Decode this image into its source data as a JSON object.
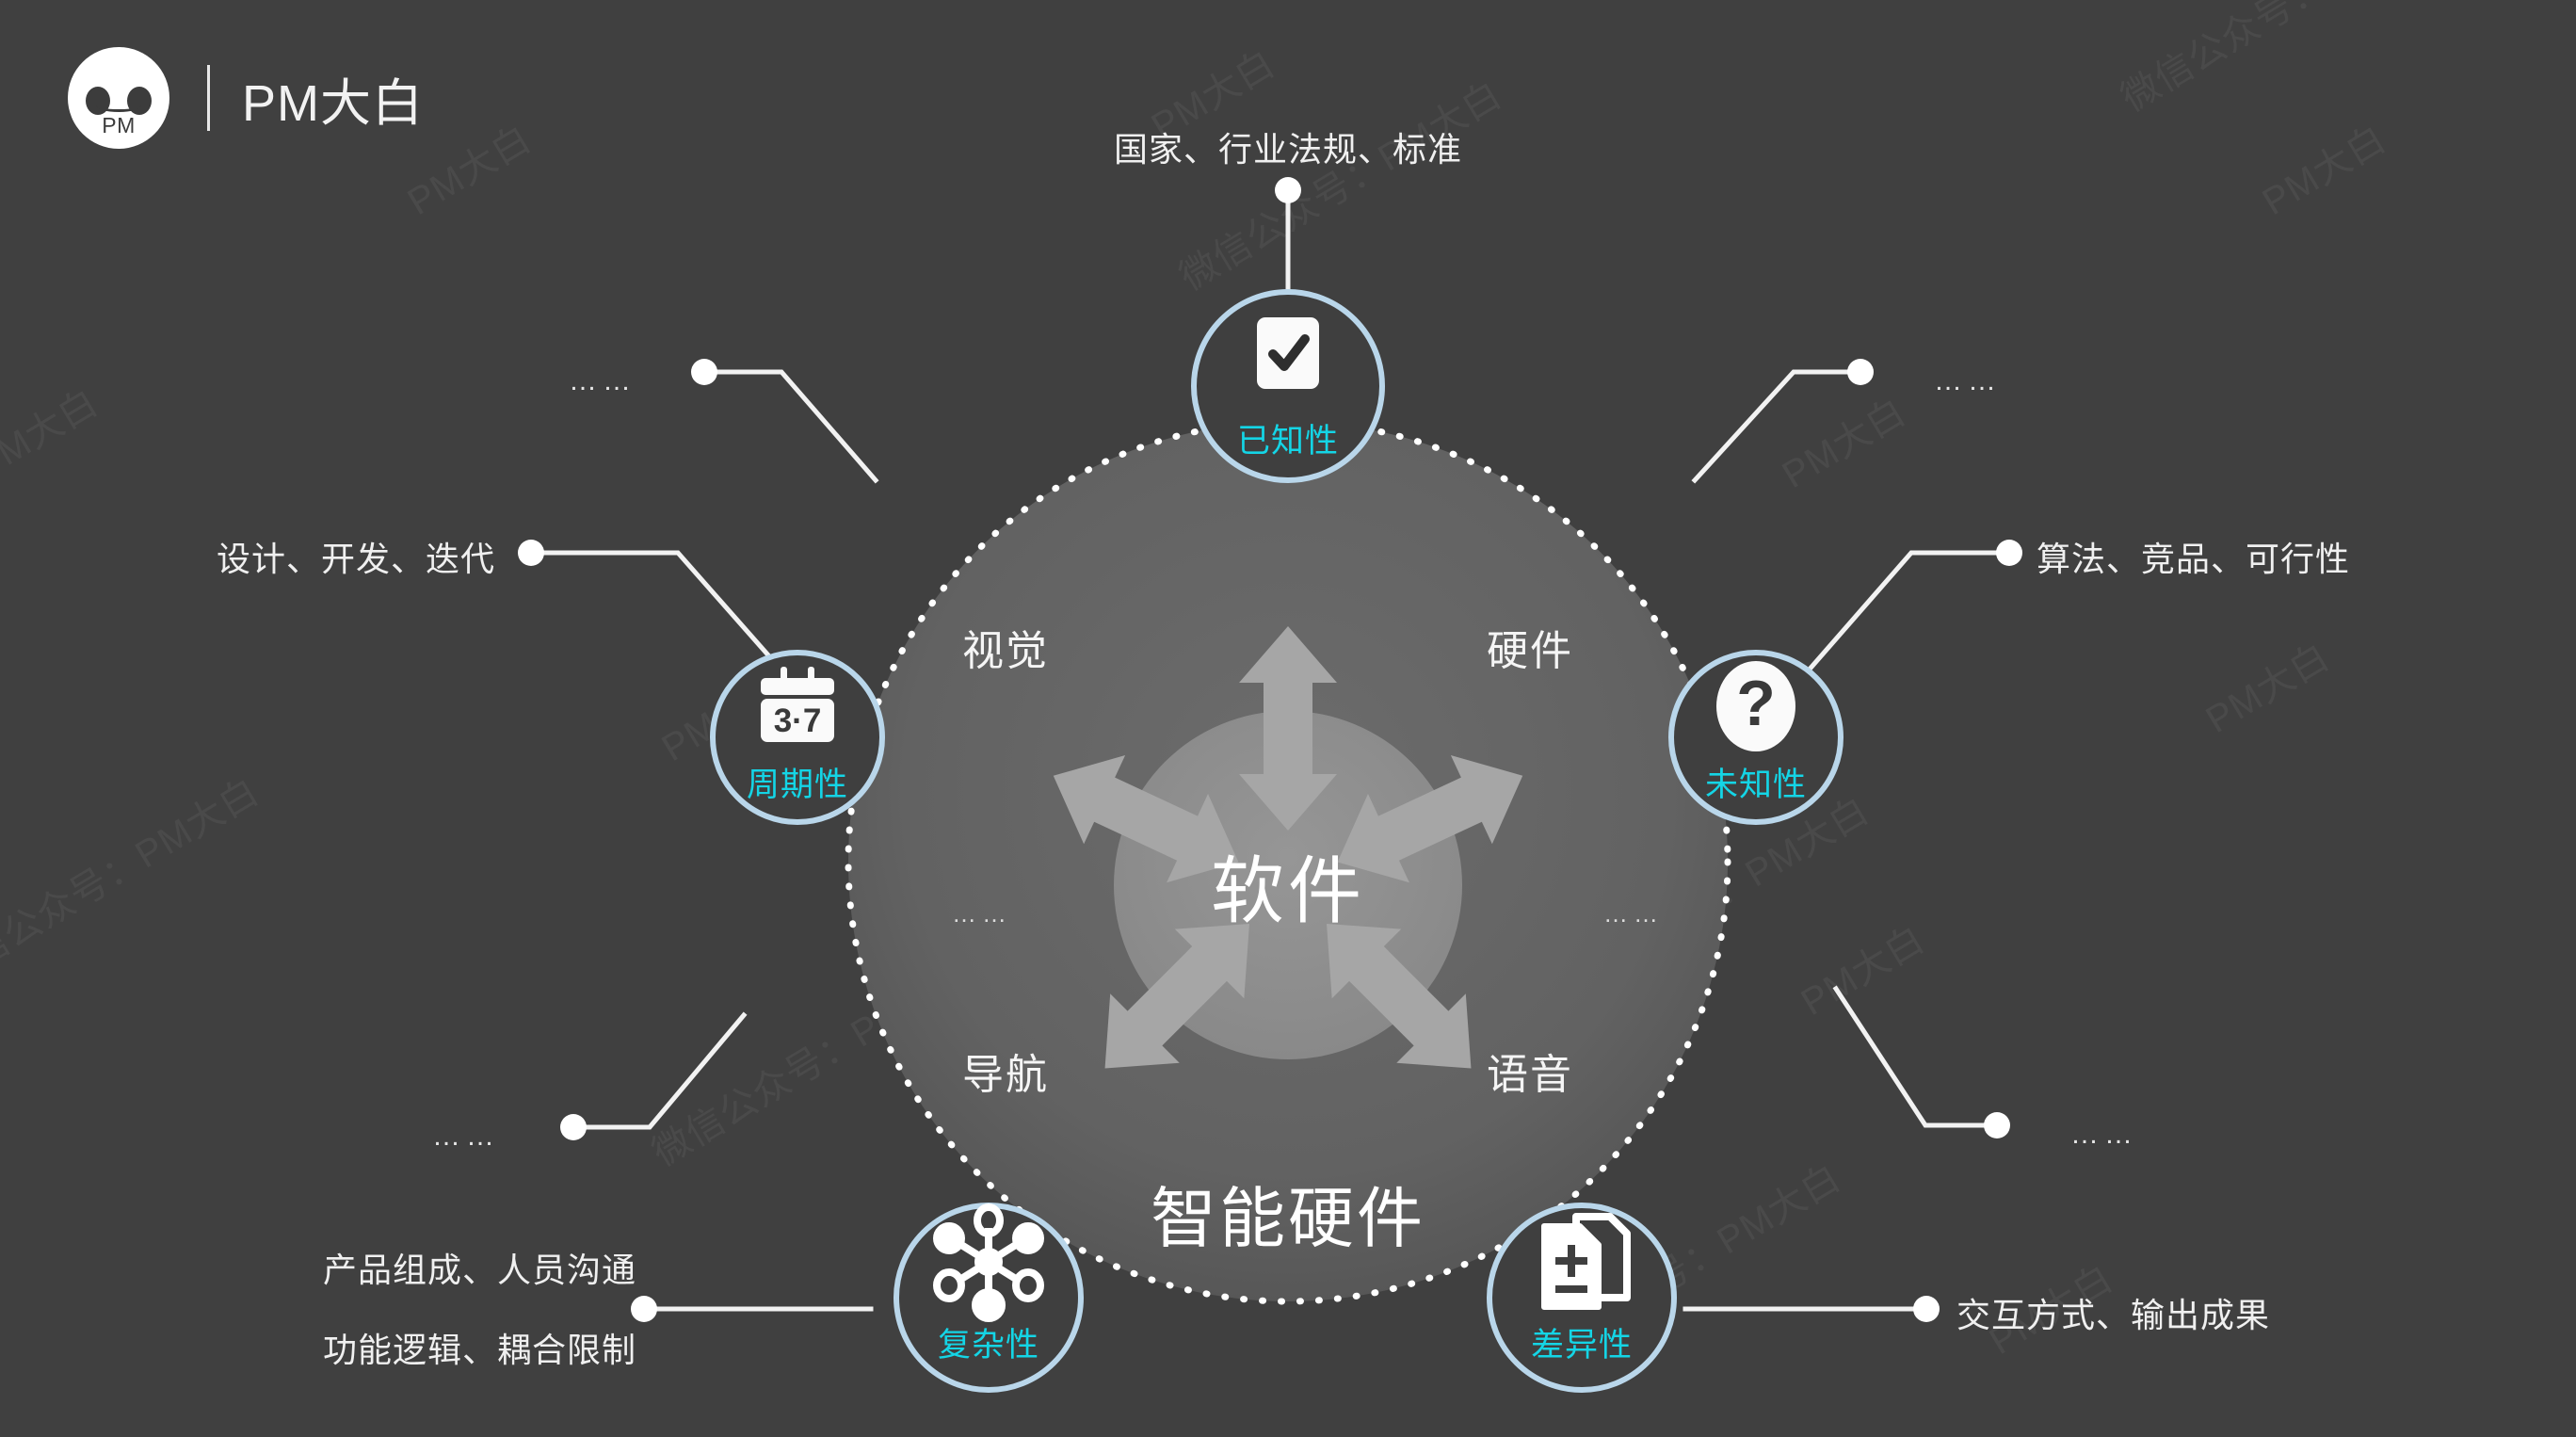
{
  "brand": {
    "logo_text": "PM",
    "logo_icon": "baymax-face-icon",
    "title": "PM大白"
  },
  "center": {
    "core_label": "软件",
    "outer_label": "智能硬件",
    "capabilities": [
      "视觉",
      "硬件",
      "导航",
      "语音"
    ],
    "inner_ellipsis_left": "……",
    "inner_ellipsis_right": "……"
  },
  "nodes": [
    {
      "id": "known",
      "title": "已知性",
      "icon": "checkbox-checked-icon",
      "leader_text": "国家、行业法规、标准"
    },
    {
      "id": "periodicity",
      "title": "周期性",
      "icon": "calendar-icon",
      "icon_text": "3·7",
      "leader_text": "设计、开发、迭代"
    },
    {
      "id": "unknown",
      "title": "未知性",
      "icon": "question-mark-circle-icon",
      "icon_text": "?",
      "leader_text": "算法、竞品、可行性"
    },
    {
      "id": "complexity",
      "title": "复杂性",
      "icon": "node-network-icon",
      "leader_text_line1": "产品组成、人员沟通",
      "leader_text_line2": "功能逻辑、耦合限制"
    },
    {
      "id": "difference",
      "title": "差异性",
      "icon": "documents-plus-minus-icon",
      "leader_text": "交互方式、输出成果"
    }
  ],
  "ellipsis_markers": [
    {
      "id": "top-left",
      "text": "……"
    },
    {
      "id": "top-right",
      "text": "……"
    },
    {
      "id": "bottom-left",
      "text": "……"
    },
    {
      "id": "bottom-right",
      "text": "……"
    }
  ],
  "watermark": {
    "short": "PM大白",
    "long": "微信公众号：PM大白"
  },
  "colors": {
    "background": "#404040",
    "accent_cyan": "#14d5e6",
    "node_ring": "#b9d6ea",
    "inner_disc": "#5a5a5a",
    "core_disc": "#8a8a8a",
    "line": "#f2f2f2",
    "text": "#f0f0f0"
  }
}
